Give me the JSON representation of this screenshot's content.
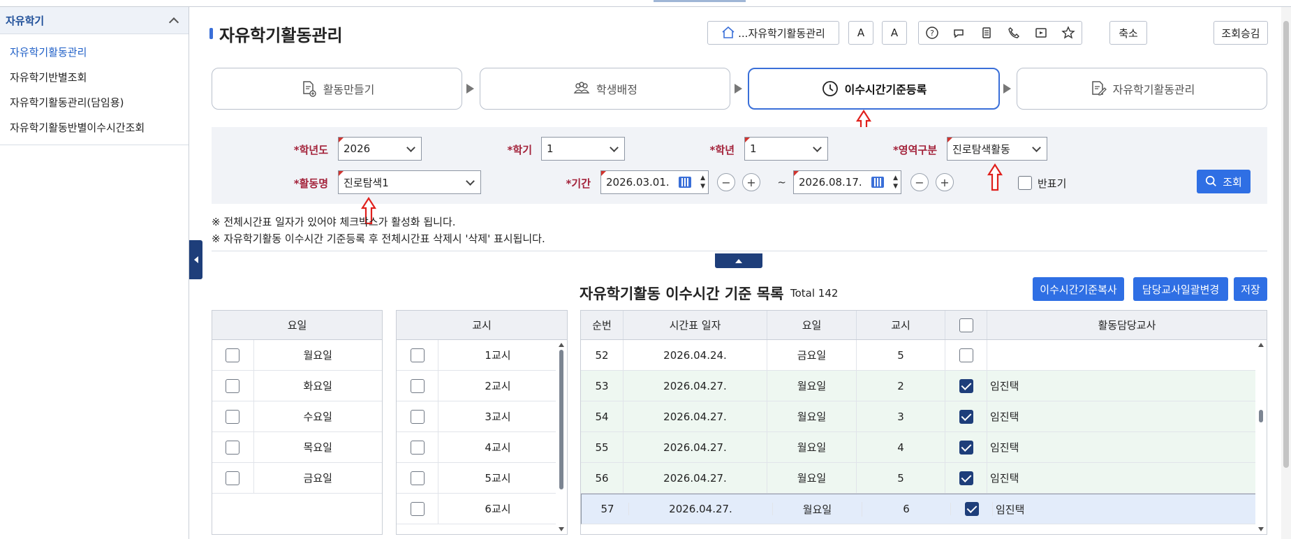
{
  "sidebar": {
    "title": "자유학기",
    "items": [
      {
        "label": "자유학기활동관리",
        "active": true
      },
      {
        "label": "자유학기반별조회",
        "active": false
      },
      {
        "label": "자유학기활동관리(담임용)",
        "active": false
      },
      {
        "label": "자유학기활동반별이수시간조회",
        "active": false
      }
    ]
  },
  "page": {
    "title": "자유학기활동관리",
    "toolbar": {
      "home_breadcrumb": "...자유학기활동관리",
      "font_a1": "A",
      "font_a2": "A",
      "shrink_label": "축소",
      "approve_label": "조회승김"
    }
  },
  "steps": [
    {
      "label": "활동만들기",
      "icon": "document-add-icon"
    },
    {
      "label": "학생배정",
      "icon": "users-icon"
    },
    {
      "label": "이수시간기준등록",
      "icon": "clock-icon",
      "active": true
    },
    {
      "label": "자유학기활동관리",
      "icon": "document-edit-icon"
    }
  ],
  "search": {
    "year_label": "*학년도",
    "year_value": "2026",
    "semester_label": "*학기",
    "semester_value": "1",
    "grade_label": "*학년",
    "grade_value": "1",
    "area_label": "*영역구분",
    "area_value": "진로탐색활동",
    "activity_label": "*활동명",
    "activity_value": "진로탐색1",
    "period_label": "*기간",
    "start_date": "2026.03.01.",
    "end_date": "2026.08.17.",
    "tilde": "~",
    "minus": "−",
    "plus": "+",
    "half_label": "반표기",
    "search_button": "조회"
  },
  "notes": [
    "※ 전체시간표 일자가 있어야 체크박스가 활성화 됩니다.",
    "※ 자유학기활동 이수시간 기준등록 후 전체시간표 삭제시 '삭제' 표시됩니다."
  ],
  "list": {
    "title": "자유학기활동 이수시간 기준 목록",
    "total": "Total 142",
    "buttons": {
      "copy": "이수시간기준복사",
      "teacher_change": "담당교사일괄변경",
      "save": "저장"
    }
  },
  "day_grid": {
    "header": "요일",
    "rows": [
      "월요일",
      "화요일",
      "수요일",
      "목요일",
      "금요일"
    ]
  },
  "period_grid": {
    "header": "교시",
    "rows": [
      "1교시",
      "2교시",
      "3교시",
      "4교시",
      "5교시",
      "6교시"
    ]
  },
  "main_grid": {
    "headers": {
      "no": "순번",
      "date": "시간표 일자",
      "day": "요일",
      "period": "교시",
      "teacher": "활동담당교사"
    },
    "rows": [
      {
        "no": "52",
        "date": "2026.04.24.",
        "day": "금요일",
        "period": "5",
        "checked": false,
        "teacher": ""
      },
      {
        "no": "53",
        "date": "2026.04.27.",
        "day": "월요일",
        "period": "2",
        "checked": true,
        "teacher": "임진택"
      },
      {
        "no": "54",
        "date": "2026.04.27.",
        "day": "월요일",
        "period": "3",
        "checked": true,
        "teacher": "임진택"
      },
      {
        "no": "55",
        "date": "2026.04.27.",
        "day": "월요일",
        "period": "4",
        "checked": true,
        "teacher": "임진택"
      },
      {
        "no": "56",
        "date": "2026.04.27.",
        "day": "월요일",
        "period": "5",
        "checked": true,
        "teacher": "임진택"
      },
      {
        "no": "57",
        "date": "2026.04.27.",
        "day": "월요일",
        "period": "6",
        "checked": true,
        "teacher": "임진택"
      }
    ]
  },
  "colors": {
    "accent": "#2f6fe4",
    "navy": "#1e3e7a",
    "required": "#a3223a",
    "arrow": "#e0201c"
  }
}
